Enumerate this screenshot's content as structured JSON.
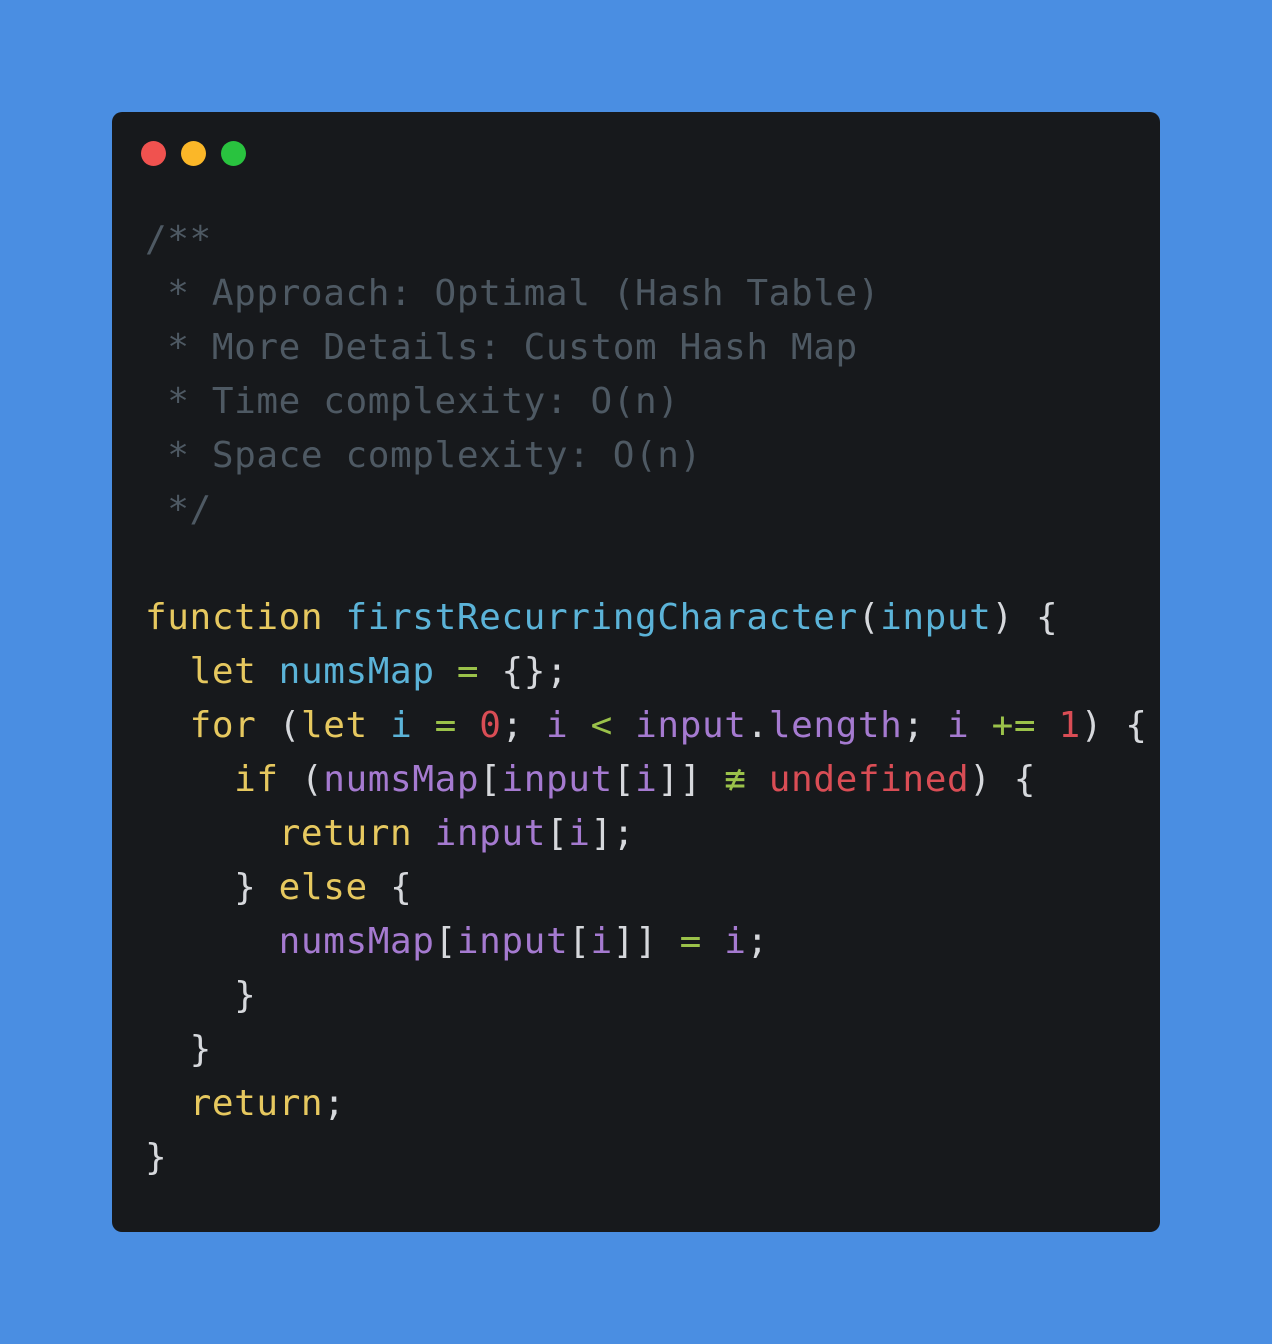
{
  "colors": {
    "background": "#4a8ee2",
    "window": "#17191c",
    "dot_close": "#f0524f",
    "dot_minimize": "#fbb728",
    "dot_maximize": "#29c33f"
  },
  "window_controls": [
    {
      "name": "close-dot",
      "color": "#f0524f"
    },
    {
      "name": "minimize-dot",
      "color": "#fbb728"
    },
    {
      "name": "maximize-dot",
      "color": "#29c33f"
    }
  ],
  "code_lines": [
    [
      {
        "t": "comment",
        "s": "/**"
      }
    ],
    [
      {
        "t": "comment",
        "s": " * Approach: Optimal (Hash Table)"
      }
    ],
    [
      {
        "t": "comment",
        "s": " * More Details: Custom Hash Map"
      }
    ],
    [
      {
        "t": "comment",
        "s": " * Time complexity: O(n)"
      }
    ],
    [
      {
        "t": "comment",
        "s": " * Space complexity: O(n)"
      }
    ],
    [
      {
        "t": "comment",
        "s": " */"
      }
    ],
    [],
    [
      {
        "t": "keyword",
        "s": "function"
      },
      {
        "t": "plain",
        "s": " "
      },
      {
        "t": "function",
        "s": "firstRecurringCharacter"
      },
      {
        "t": "punct",
        "s": "("
      },
      {
        "t": "variable",
        "s": "input"
      },
      {
        "t": "punct",
        "s": ") {"
      }
    ],
    [
      {
        "t": "plain",
        "s": "  "
      },
      {
        "t": "keyword",
        "s": "let"
      },
      {
        "t": "plain",
        "s": " "
      },
      {
        "t": "variable",
        "s": "numsMap"
      },
      {
        "t": "plain",
        "s": " "
      },
      {
        "t": "operator",
        "s": "="
      },
      {
        "t": "plain",
        "s": " "
      },
      {
        "t": "punct",
        "s": "{};"
      }
    ],
    [
      {
        "t": "plain",
        "s": "  "
      },
      {
        "t": "keyword",
        "s": "for"
      },
      {
        "t": "plain",
        "s": " "
      },
      {
        "t": "punct",
        "s": "("
      },
      {
        "t": "keyword",
        "s": "let"
      },
      {
        "t": "plain",
        "s": " "
      },
      {
        "t": "variable",
        "s": "i"
      },
      {
        "t": "plain",
        "s": " "
      },
      {
        "t": "operator",
        "s": "="
      },
      {
        "t": "plain",
        "s": " "
      },
      {
        "t": "number",
        "s": "0"
      },
      {
        "t": "punct",
        "s": ";"
      },
      {
        "t": "plain",
        "s": " "
      },
      {
        "t": "param",
        "s": "i"
      },
      {
        "t": "plain",
        "s": " "
      },
      {
        "t": "operator",
        "s": "<"
      },
      {
        "t": "plain",
        "s": " "
      },
      {
        "t": "param",
        "s": "input"
      },
      {
        "t": "punct",
        "s": "."
      },
      {
        "t": "property",
        "s": "length"
      },
      {
        "t": "punct",
        "s": ";"
      },
      {
        "t": "plain",
        "s": " "
      },
      {
        "t": "param",
        "s": "i"
      },
      {
        "t": "plain",
        "s": " "
      },
      {
        "t": "operator",
        "s": "+="
      },
      {
        "t": "plain",
        "s": " "
      },
      {
        "t": "number",
        "s": "1"
      },
      {
        "t": "punct",
        "s": ") {"
      }
    ],
    [
      {
        "t": "plain",
        "s": "    "
      },
      {
        "t": "keyword",
        "s": "if"
      },
      {
        "t": "plain",
        "s": " "
      },
      {
        "t": "punct",
        "s": "("
      },
      {
        "t": "param",
        "s": "numsMap"
      },
      {
        "t": "punct",
        "s": "["
      },
      {
        "t": "param",
        "s": "input"
      },
      {
        "t": "punct",
        "s": "["
      },
      {
        "t": "param",
        "s": "i"
      },
      {
        "t": "punct",
        "s": "]]"
      },
      {
        "t": "plain",
        "s": " "
      },
      {
        "t": "operator",
        "s": "≢"
      },
      {
        "t": "plain",
        "s": " "
      },
      {
        "t": "constant",
        "s": "undefined"
      },
      {
        "t": "punct",
        "s": ") {"
      }
    ],
    [
      {
        "t": "plain",
        "s": "      "
      },
      {
        "t": "keyword",
        "s": "return"
      },
      {
        "t": "plain",
        "s": " "
      },
      {
        "t": "param",
        "s": "input"
      },
      {
        "t": "punct",
        "s": "["
      },
      {
        "t": "param",
        "s": "i"
      },
      {
        "t": "punct",
        "s": "];"
      }
    ],
    [
      {
        "t": "plain",
        "s": "    "
      },
      {
        "t": "punct",
        "s": "}"
      },
      {
        "t": "plain",
        "s": " "
      },
      {
        "t": "keyword",
        "s": "else"
      },
      {
        "t": "plain",
        "s": " "
      },
      {
        "t": "punct",
        "s": "{"
      }
    ],
    [
      {
        "t": "plain",
        "s": "      "
      },
      {
        "t": "param",
        "s": "numsMap"
      },
      {
        "t": "punct",
        "s": "["
      },
      {
        "t": "param",
        "s": "input"
      },
      {
        "t": "punct",
        "s": "["
      },
      {
        "t": "param",
        "s": "i"
      },
      {
        "t": "punct",
        "s": "]]"
      },
      {
        "t": "plain",
        "s": " "
      },
      {
        "t": "operator",
        "s": "="
      },
      {
        "t": "plain",
        "s": " "
      },
      {
        "t": "param",
        "s": "i"
      },
      {
        "t": "punct",
        "s": ";"
      }
    ],
    [
      {
        "t": "plain",
        "s": "    "
      },
      {
        "t": "punct",
        "s": "}"
      }
    ],
    [
      {
        "t": "plain",
        "s": "  "
      },
      {
        "t": "punct",
        "s": "}"
      }
    ],
    [
      {
        "t": "plain",
        "s": "  "
      },
      {
        "t": "keyword",
        "s": "return"
      },
      {
        "t": "punct",
        "s": ";"
      }
    ],
    [
      {
        "t": "punct",
        "s": "}"
      }
    ]
  ]
}
